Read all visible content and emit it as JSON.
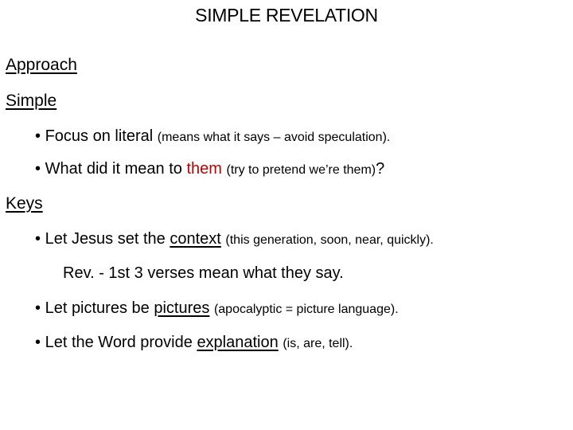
{
  "title": "SIMPLE REVELATION",
  "sections": [
    {
      "heading": "Approach"
    },
    {
      "heading": "Simple"
    },
    {
      "heading": "Keys"
    }
  ],
  "bullets": {
    "b1": {
      "bullet": "•",
      "main": "Focus on literal",
      "note": "(means what it says – avoid speculation)."
    },
    "b2": {
      "bullet": "•",
      "main": "What did it mean to",
      "highlight": "them",
      "note": "(try to pretend we’re them)",
      "end": "?"
    },
    "b3": {
      "bullet": "•",
      "main": "Let Jesus set the",
      "emph": "context",
      "note": "(this generation, soon, near, quickly)."
    },
    "b3sub": "Rev. - 1st 3 verses mean what they say.",
    "b4": {
      "bullet": "•",
      "main": "Let pictures be",
      "emph": "pictures",
      "note": "(apocalyptic = picture language)."
    },
    "b5": {
      "bullet": "•",
      "main": "Let the Word provide",
      "emph": "explanation",
      "note": "(is, are, tell)."
    }
  },
  "colors": {
    "highlight": "#c00000"
  }
}
